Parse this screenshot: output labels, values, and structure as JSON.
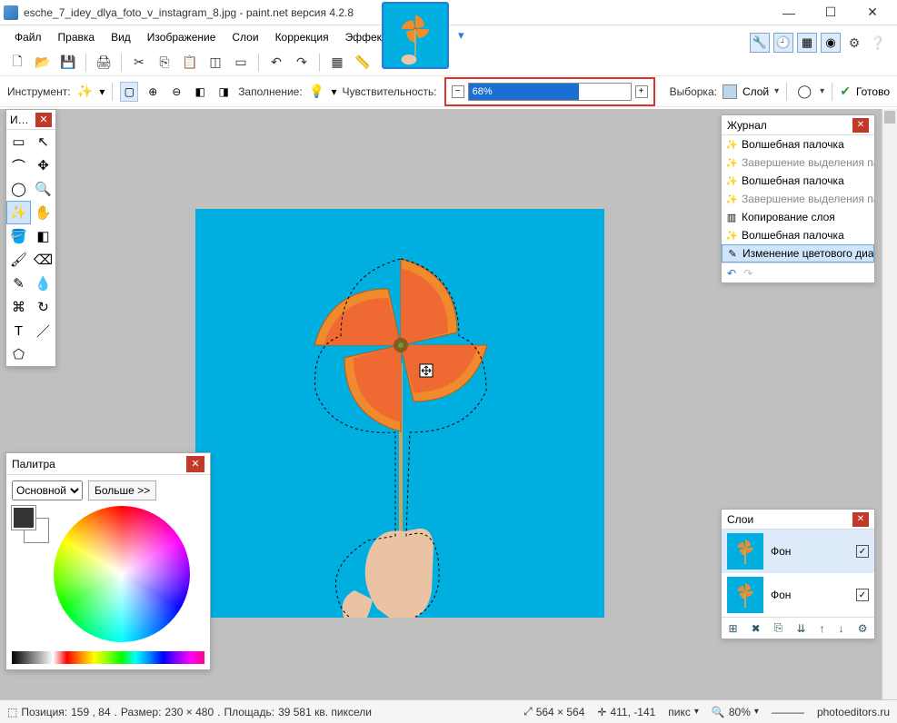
{
  "title": "esche_7_idey_dlya_foto_v_instagram_8.jpg - paint.net версия 4.2.8",
  "menu": [
    "Файл",
    "Правка",
    "Вид",
    "Изображение",
    "Слои",
    "Коррекция",
    "Эффекты"
  ],
  "toolbar2": {
    "tool_label": "Инструмент:",
    "fill_label": "Заполнение:",
    "tolerance_label": "Чувствительность:",
    "tolerance_value": "68%",
    "tolerance_percent": 68,
    "selection_label": "Выборка:",
    "selection_mode": "Слой",
    "commit_label": "Готово"
  },
  "tools_window": {
    "title": "И…"
  },
  "palette": {
    "title": "Палитра",
    "mode": "Основной",
    "more": "Больше >>"
  },
  "history": {
    "title": "Журнал",
    "items": [
      {
        "label": "Волшебная палочка",
        "icon": "✨",
        "dim": false
      },
      {
        "label": "Завершение выделения палочкой",
        "icon": "✨",
        "dim": true
      },
      {
        "label": "Волшебная палочка",
        "icon": "✨",
        "dim": false
      },
      {
        "label": "Завершение выделения палочкой",
        "icon": "✨",
        "dim": true
      },
      {
        "label": "Копирование слоя",
        "icon": "▥",
        "dim": false
      },
      {
        "label": "Волшебная палочка",
        "icon": "✨",
        "dim": false
      },
      {
        "label": "Изменение цветового диапазона",
        "icon": "✎",
        "dim": false,
        "selected": true
      }
    ]
  },
  "layers": {
    "title": "Слои",
    "rows": [
      {
        "name": "Фон",
        "selected": true,
        "visible": true
      },
      {
        "name": "Фон",
        "selected": false,
        "visible": true
      }
    ]
  },
  "status": {
    "pos_label": "Позиция:",
    "pos": "159 , 84",
    "size_label": "Размер:",
    "size": "230   × 480",
    "area_label": "Площадь:",
    "area": "39 581 кв. пиксели",
    "canvas_size": "564 × 564",
    "cursor": "411, -141",
    "unit": "пикс",
    "zoom": "80%",
    "credit": "photoeditors.ru"
  }
}
